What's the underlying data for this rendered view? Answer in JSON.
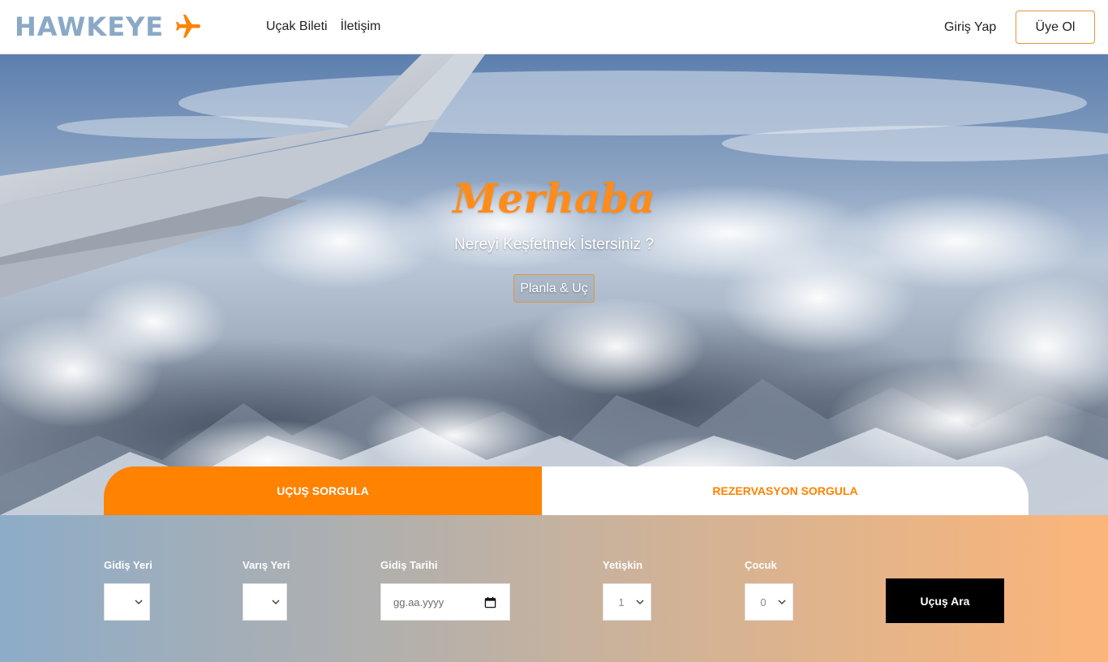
{
  "brand": {
    "name": "HAWKEYE",
    "accent_color": "#ff8200",
    "logo_color": "#8aa9c6",
    "icon": "airplane-icon"
  },
  "nav": {
    "links": [
      "Uçak Bileti",
      "İletişim"
    ],
    "login_label": "Giriş Yap",
    "signup_label": "Üye Ol"
  },
  "hero": {
    "title": "Merhaba",
    "subtitle": "Nereyi Keşfetmek İstersiniz ?",
    "cta_label": "Planla & Uç"
  },
  "tabs": {
    "active_label": "UÇUŞ SORGULA",
    "inactive_label": "REZERVASYON SORGULA"
  },
  "form": {
    "from_label": "Gidiş Yeri",
    "from_value": "",
    "to_label": "Varış Yeri",
    "to_value": "",
    "date_label": "Gidiş Tarihi",
    "date_placeholder": "gg.aa.yyyy",
    "adult_label": "Yetişkin",
    "adult_value": "1",
    "child_label": "Çocuk",
    "child_value": "0",
    "submit_label": "Uçuş Ara"
  }
}
